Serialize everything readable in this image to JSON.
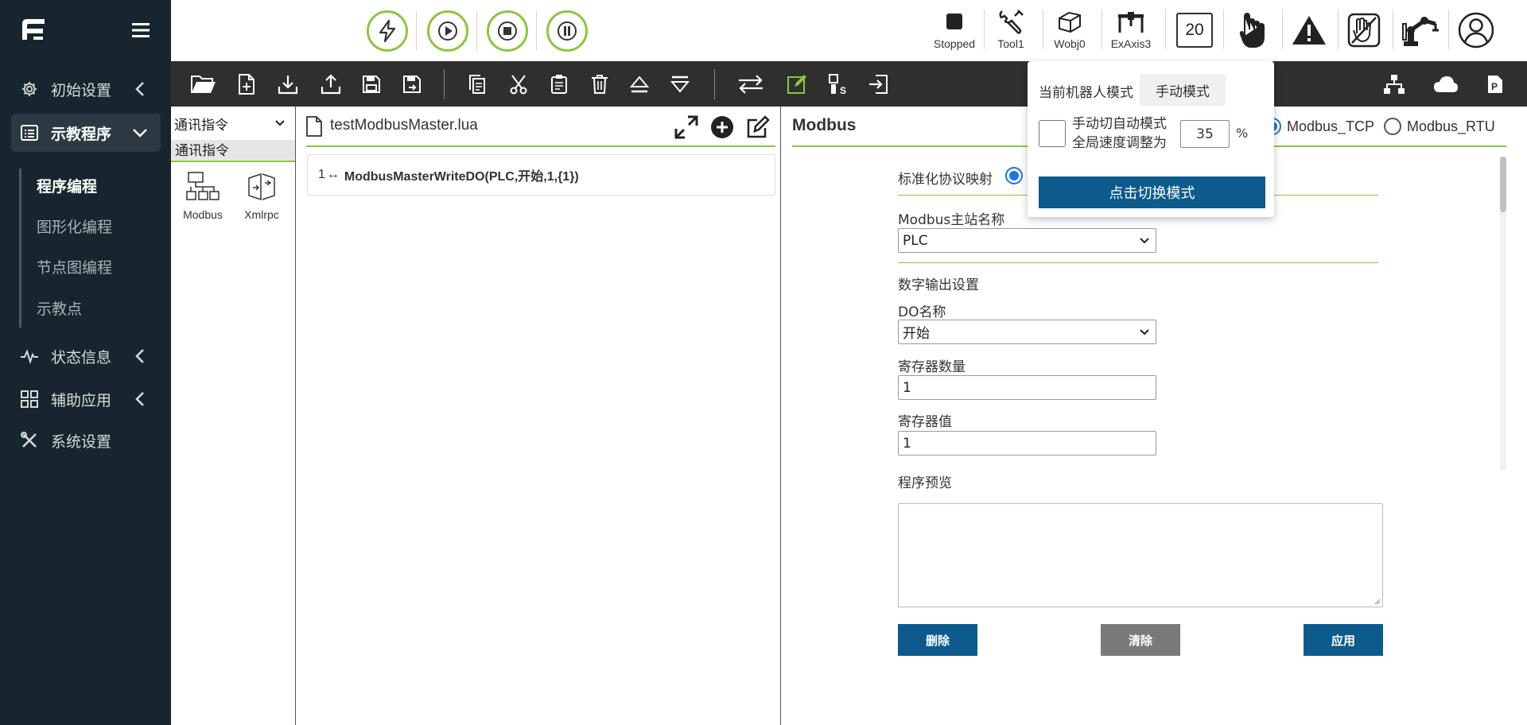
{
  "sidebar": {
    "nav": [
      {
        "label": "初始设置"
      },
      {
        "label": "示教程序"
      },
      {
        "label": "状态信息"
      },
      {
        "label": "辅助应用"
      },
      {
        "label": "系统设置"
      }
    ],
    "submenu": [
      {
        "label": "程序编程"
      },
      {
        "label": "图形化编程"
      },
      {
        "label": "节点图编程"
      },
      {
        "label": "示教点"
      }
    ]
  },
  "topbar": {
    "status": {
      "label": "Stopped"
    },
    "tool": {
      "label": "Tool1"
    },
    "wobj": {
      "label": "Wobj0"
    },
    "exaxis": {
      "label": "ExAxis3"
    },
    "speed": "20"
  },
  "instructions": {
    "select_value": "通讯指令",
    "category": "通讯指令",
    "tiles": [
      {
        "label": "Modbus"
      },
      {
        "label": "Xmlrpc"
      }
    ]
  },
  "editor": {
    "file_name": "testModbusMaster.lua",
    "line_number": "1",
    "line_code": "ModbusMasterWriteDO(PLC,开始,1,{1})"
  },
  "modbus": {
    "title": "Modbus",
    "protocols": [
      {
        "label": "Modbus_TCP",
        "selected": true
      },
      {
        "label": "Modbus_RTU",
        "selected": false
      }
    ],
    "std_mapping_label": "标准化协议映射",
    "master_name_label": "Modbus主站名称",
    "master_name_value": "PLC",
    "do_section_label": "数字输出设置",
    "do_name_label": "DO名称",
    "do_name_value": "开始",
    "reg_count_label": "寄存器数量",
    "reg_count_value": "1",
    "reg_value_label": "寄存器值",
    "reg_value_value": "1",
    "preview_label": "程序预览",
    "delete_label": "删除",
    "clear_label": "清除",
    "apply_label": "应用"
  },
  "mode_popup": {
    "current_label": "当前机器人模式",
    "current_mode": "手动模式",
    "switch_text_1": "手动切自动模式",
    "switch_text_2": "全局速度调整为",
    "speed_value": "35",
    "percent": "%",
    "switch_button": "点击切换模式"
  },
  "colors": {
    "sidebar_bg": "#17262e",
    "accent_green": "#8cc63f",
    "toolbar_bg": "#2f2f2f",
    "primary_blue": "#0d5b8c",
    "grey_button": "#7a7a7a",
    "radio_blue": "#1a73e8"
  }
}
